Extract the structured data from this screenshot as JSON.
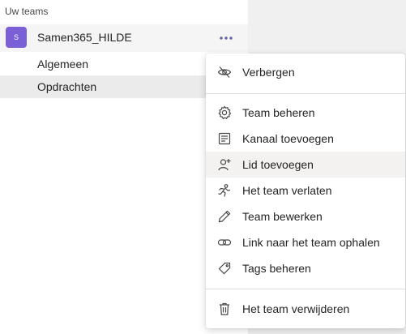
{
  "sidebar": {
    "section_label": "Uw teams",
    "team": {
      "avatar_letter": "S",
      "avatar_color": "#7b5fd6",
      "name": "Samen365_HILDE",
      "more_icon": "ellipsis-icon"
    },
    "channels": [
      {
        "label": "Algemeen",
        "selected": false
      },
      {
        "label": "Opdrachten",
        "selected": true
      }
    ]
  },
  "context_menu": {
    "items": [
      {
        "label": "Verbergen",
        "icon": "eye-off-icon"
      },
      {
        "label": "Team beheren",
        "icon": "gear-icon"
      },
      {
        "label": "Kanaal toevoegen",
        "icon": "add-channel-icon"
      },
      {
        "label": "Lid toevoegen",
        "icon": "add-person-icon",
        "hovered": true
      },
      {
        "label": "Het team verlaten",
        "icon": "leave-icon"
      },
      {
        "label": "Team bewerken",
        "icon": "pencil-icon"
      },
      {
        "label": "Link naar het team ophalen",
        "icon": "link-icon"
      },
      {
        "label": "Tags beheren",
        "icon": "tag-icon"
      },
      {
        "label": "Het team verwijderen",
        "icon": "trash-icon"
      }
    ]
  },
  "colors": {
    "accent": "#6264a7",
    "hover": "#f3f2f1",
    "selected_channel": "#ebebeb"
  }
}
